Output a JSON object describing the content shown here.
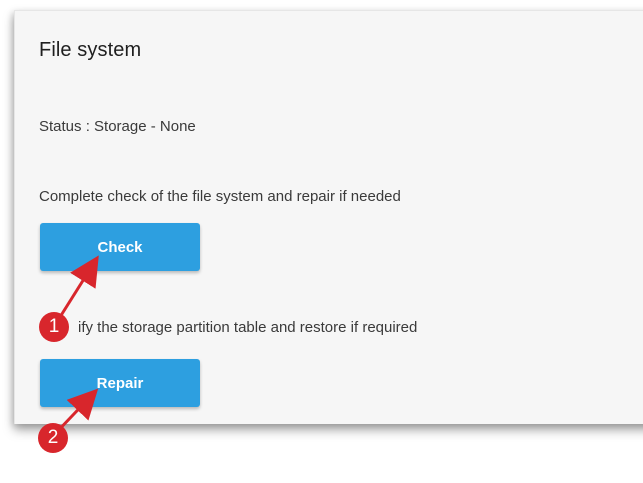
{
  "panel": {
    "title": "File system",
    "status": "Status : Storage - None",
    "check_description": "Complete check of the file system and repair if needed",
    "check_button": "Check",
    "repair_description": "Verify the storage partition table and restore if required",
    "repair_description_visible": "ify the storage partition table and restore if required",
    "repair_button": "Repair"
  },
  "callouts": {
    "first": "1",
    "second": "2"
  },
  "colors": {
    "button": "#2d9fe0",
    "callout": "#d8262c",
    "panel_bg": "#f6f6f6"
  }
}
